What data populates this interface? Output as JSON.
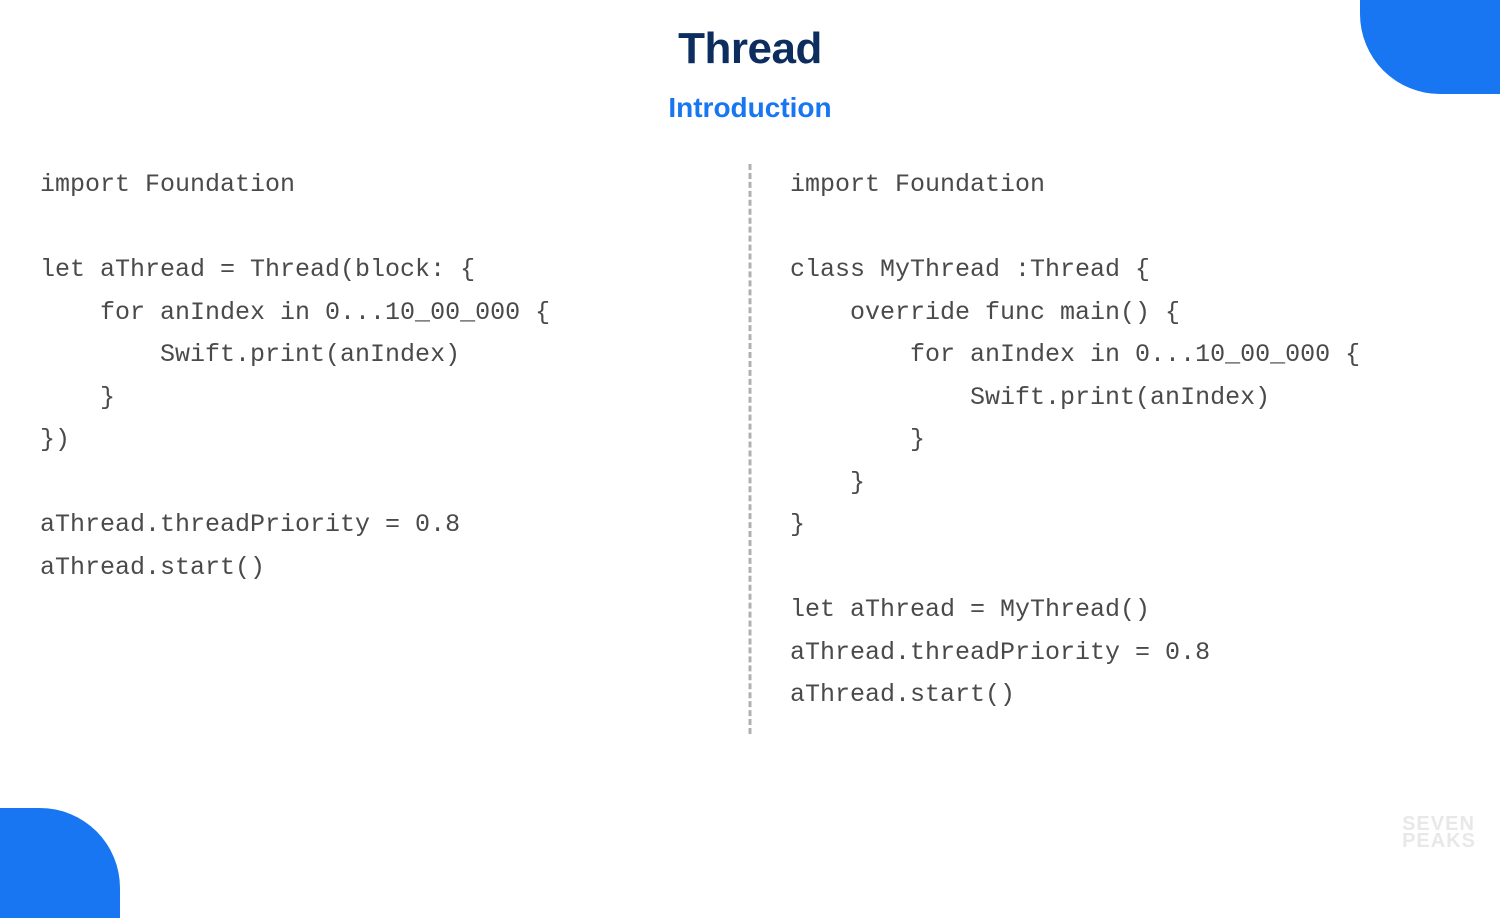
{
  "header": {
    "title": "Thread",
    "subtitle": "Introduction"
  },
  "code": {
    "left": "import Foundation\n\nlet aThread = Thread(block: {\n    for anIndex in 0...10_00_000 {\n        Swift.print(anIndex)\n    }\n})\n\naThread.threadPriority = 0.8\naThread.start()",
    "right": "import Foundation\n\nclass MyThread :Thread {\n    override func main() {\n        for anIndex in 0...10_00_000 {\n            Swift.print(anIndex)\n        }\n    }\n}\n\nlet aThread = MyThread()\naThread.threadPriority = 0.8\naThread.start()"
  },
  "watermark": {
    "line1": "SEVEN",
    "line2": "PEAKS"
  }
}
